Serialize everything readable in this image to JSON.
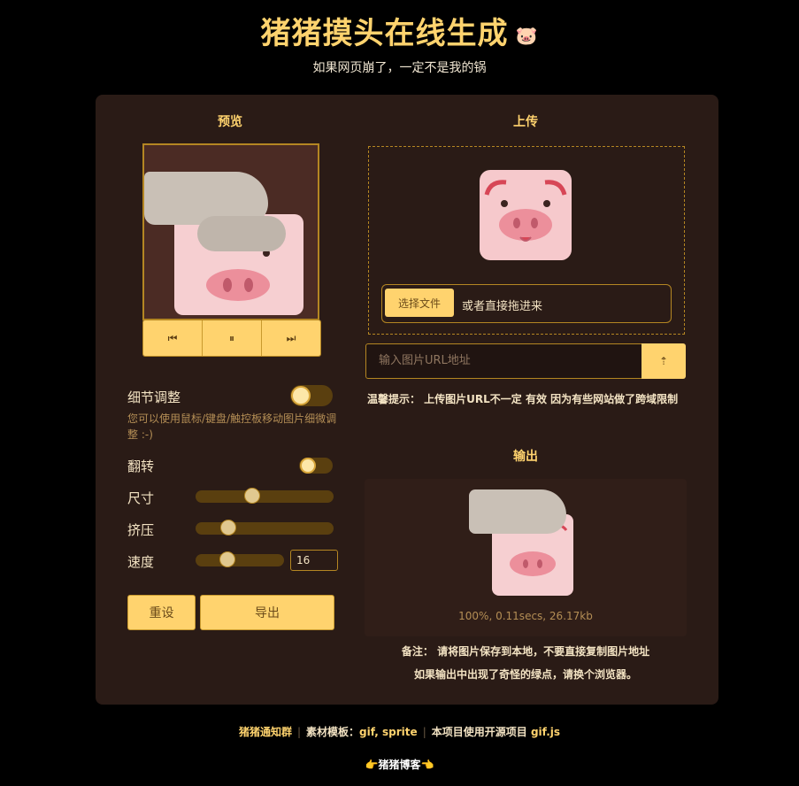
{
  "header": {
    "title": "猪猪摸头在线生成",
    "title_emoji": "🐷",
    "subtitle": "如果网页崩了，一定不是我的锅"
  },
  "preview": {
    "section_title": "预览",
    "controls": [
      "⏮",
      "⏸",
      "⏭"
    ]
  },
  "settings": {
    "detail_label": "细节调整",
    "detail_help": "您可以使用鼠标/键盘/触控板移动图片细微调整 :-)",
    "flip_label": "翻转",
    "size_label": "尺寸",
    "squeeze_label": "挤压",
    "speed_label": "速度",
    "speed_value": "16",
    "reset_label": "重设",
    "export_label": "导出"
  },
  "upload": {
    "section_title": "上传",
    "choose_file_label": "选择文件",
    "drag_hint": "或者直接拖进来",
    "url_placeholder": "输入图片URL地址",
    "url_button_icon": "⇡",
    "tip": "温馨提示：  上传图片URL不一定 有效 因为有些网站做了跨域限制"
  },
  "output": {
    "section_title": "输出",
    "stats": "100%, 0.11secs, 26.17kb",
    "note1": "备注：  请将图片保存到本地，不要直接复制图片地址",
    "note2": "如果输出中出现了奇怪的绿点，请换个浏览器。"
  },
  "footer": {
    "group_link": "猪猪通知群",
    "template_label": "素材模板：",
    "template_links": "gif, sprite",
    "project_label": "本项目使用开源项目",
    "project_link": "gif.js",
    "bottom_tag": "👉猪猪博客👈"
  },
  "colors": {
    "accent": "#ffd36e",
    "card_bg": "#2a1b16",
    "page_bg": "#000000"
  }
}
